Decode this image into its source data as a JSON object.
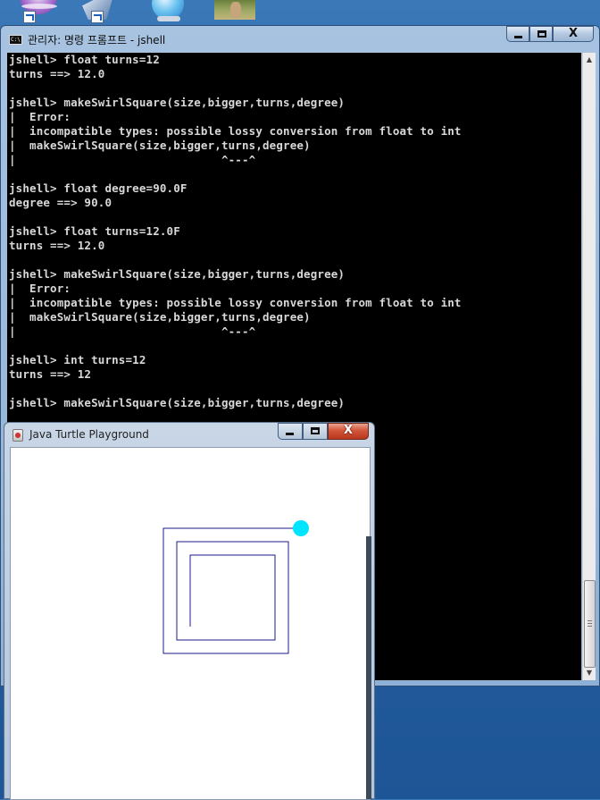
{
  "desktop": {
    "icons": [
      "app-icon-purple",
      "shortcut-icon",
      "globe-icon",
      "rabbit-photo-icon"
    ]
  },
  "cmd_window": {
    "title": "관리자: 명령 프롬프트 - jshell",
    "icon_text": "C:\\",
    "buttons": {
      "minimize": "minimize",
      "maximize": "maximize",
      "close": "X"
    },
    "lines": [
      "jshell> float turns=12",
      "turns ==> 12.0",
      "",
      "jshell> makeSwirlSquare(size,bigger,turns,degree)",
      "|  Error:",
      "|  incompatible types: possible lossy conversion from float to int",
      "|  makeSwirlSquare(size,bigger,turns,degree)",
      "|                              ^---^",
      "",
      "jshell> float degree=90.0F",
      "degree ==> 90.0",
      "",
      "jshell> float turns=12.0F",
      "turns ==> 12.0",
      "",
      "jshell> makeSwirlSquare(size,bigger,turns,degree)",
      "|  Error:",
      "|  incompatible types: possible lossy conversion from float to int",
      "|  makeSwirlSquare(size,bigger,turns,degree)",
      "|                              ^---^",
      "",
      "jshell> int turns=12",
      "turns ==> 12",
      "",
      "jshell> makeSwirlSquare(size,bigger,turns,degree)"
    ]
  },
  "turtle_window": {
    "title": "Java Turtle Playground",
    "buttons": {
      "minimize": "minimize",
      "maximize": "maximize",
      "close": "X"
    },
    "drawing": {
      "line_color": "#1a1a8c",
      "turtle_color": "#00e5ff"
    }
  }
}
